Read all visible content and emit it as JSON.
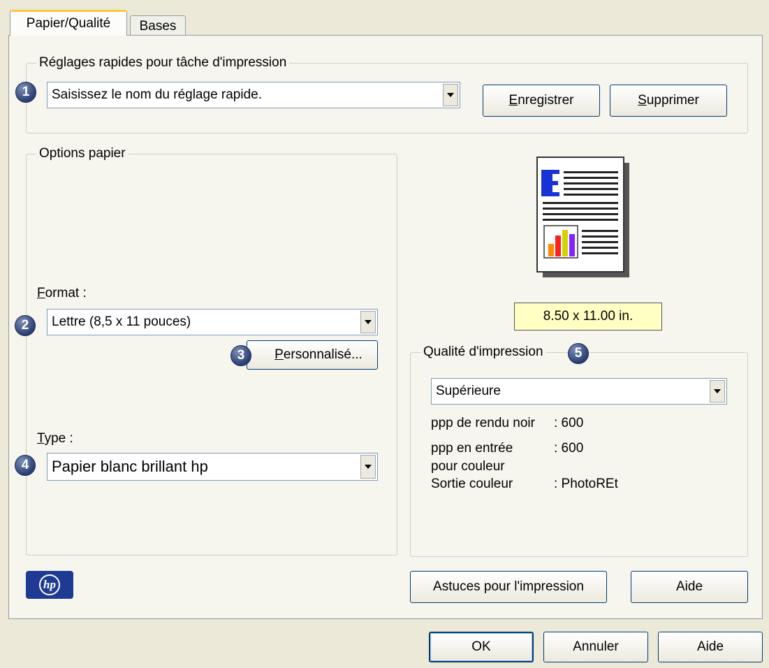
{
  "tabs": [
    "Papier/Qualité",
    "Bases"
  ],
  "quick_settings": {
    "legend": "Réglages rapides pour tâche d'impression",
    "badge": "1",
    "combo_value": "Saisissez le nom du réglage rapide.",
    "save_label": "Enregistrer",
    "delete_label": "Supprimer"
  },
  "paper_options": {
    "legend": "Options papier",
    "format_label": "Format :",
    "format_badge": "2",
    "format_value": "Lettre (8,5 x 11 pouces)",
    "custom_badge": "3",
    "custom_label": "Personnalisé...",
    "type_label": "Type :",
    "type_badge": "4",
    "type_value": "Papier blanc brillant hp"
  },
  "preview": {
    "size_label": "8.50 x 11.00 in.",
    "letter": "E"
  },
  "print_quality": {
    "legend": "Qualité d'impression",
    "badge": "5",
    "combo_value": "Supérieure",
    "rows": [
      {
        "label": "ppp de rendu noir",
        "value": ": 600"
      },
      {
        "label": "ppp en entrée\npour couleur",
        "value": ": 600"
      },
      {
        "label": "Sortie couleur",
        "value": ": PhotoREt"
      }
    ]
  },
  "panel_buttons": {
    "tips_label": "Astuces pour l'impression",
    "help_label": "Aide"
  },
  "logo_text": "hp",
  "dialog_buttons": {
    "ok_label": "OK",
    "cancel_label": "Annuler",
    "help_label": "Aide"
  },
  "colors": {
    "badge": "#2a3f72",
    "tab_accent": "#ffc83c",
    "size_label_bg": "#ffffc4",
    "hp_logo": "#1f3a93"
  }
}
